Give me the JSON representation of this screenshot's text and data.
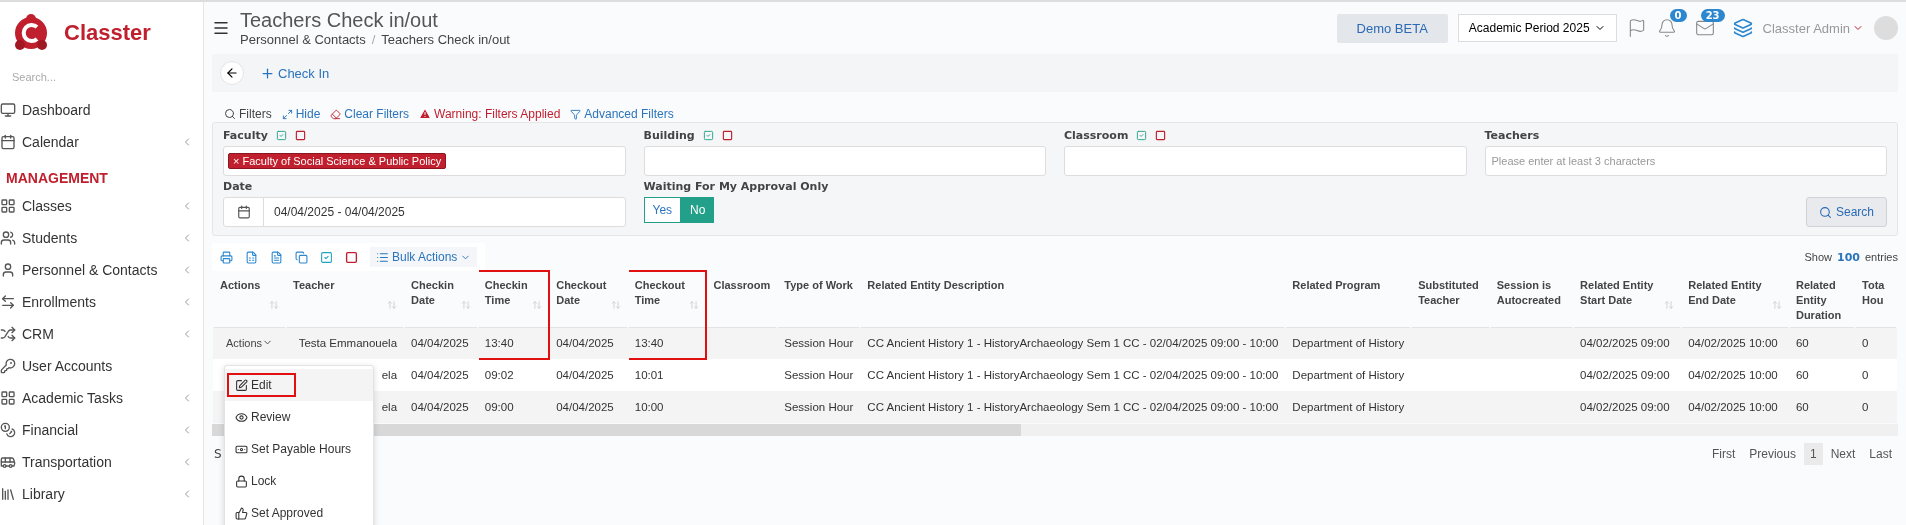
{
  "brand": {
    "name": "Classter"
  },
  "sidebar": {
    "search_placeholder": "Search...",
    "items": [
      {
        "label": "Dashboard",
        "kind": "link",
        "expandable": false
      },
      {
        "label": "Calendar",
        "kind": "link",
        "expandable": true
      },
      {
        "label": "MANAGEMENT",
        "kind": "section"
      },
      {
        "label": "Classes",
        "kind": "link",
        "expandable": true
      },
      {
        "label": "Students",
        "kind": "link",
        "expandable": true
      },
      {
        "label": "Personnel & Contacts",
        "kind": "link",
        "expandable": true
      },
      {
        "label": "Enrollments",
        "kind": "link",
        "expandable": true
      },
      {
        "label": "CRM",
        "kind": "link",
        "expandable": true
      },
      {
        "label": "User Accounts",
        "kind": "link",
        "expandable": false
      },
      {
        "label": "Academic Tasks",
        "kind": "link",
        "expandable": true
      },
      {
        "label": "Financial",
        "kind": "link",
        "expandable": true
      },
      {
        "label": "Transportation",
        "kind": "link",
        "expandable": true
      },
      {
        "label": "Library",
        "kind": "link",
        "expandable": true
      }
    ]
  },
  "header": {
    "title": "Teachers Check in/out",
    "breadcrumb": [
      "Personnel & Contacts",
      "Teachers Check in/out"
    ],
    "breadcrumb_separator": "/",
    "demo_button": "Demo BETA",
    "period": "Academic Period 2025",
    "notifications": "0",
    "messages": "23",
    "user": "Classter Admin"
  },
  "toolbar": {
    "check_in": "Check In"
  },
  "filters": {
    "label": "Filters",
    "hide": "Hide",
    "clear": "Clear Filters",
    "warning": "Warning: Filters Applied",
    "advanced": "Advanced Filters",
    "fields": [
      {
        "label": "Faculty",
        "kind": "tags",
        "tags": [
          {
            "remove": "×",
            "label": "Faculty of Social Science & Public Policy"
          }
        ]
      },
      {
        "label": "Building",
        "kind": "tags"
      },
      {
        "label": "Classroom",
        "kind": "tags"
      },
      {
        "label": "Teachers",
        "kind": "text",
        "placeholder": "Please enter at least 3 characters"
      }
    ],
    "date": {
      "label": "Date",
      "value": "04/04/2025 - 04/04/2025"
    },
    "approval": {
      "label": "Waiting For My Approval Only",
      "options": [
        {
          "label": "Yes",
          "selected": false
        },
        {
          "label": "No",
          "selected": true
        }
      ]
    },
    "search_button": "Search"
  },
  "table_tools": {
    "bulk_actions": "Bulk Actions",
    "show": "Show",
    "page_size": "100",
    "entries": "entries"
  },
  "table": {
    "columns": [
      {
        "label": "Actions",
        "sortable": true,
        "highlighted": false
      },
      {
        "label": "Teacher",
        "sortable": true,
        "highlighted": false
      },
      {
        "label": "Checkin Date",
        "sortable": true,
        "highlighted": false
      },
      {
        "label": "Checkin Time",
        "sortable": true,
        "highlighted": true
      },
      {
        "label": "Checkout Date",
        "sortable": true,
        "highlighted": false
      },
      {
        "label": "Checkout Time",
        "sortable": true,
        "highlighted": true
      },
      {
        "label": "Classroom",
        "sortable": false,
        "highlighted": false
      },
      {
        "label": "Type of Work",
        "sortable": false,
        "highlighted": false
      },
      {
        "label": "Related Entity Description",
        "sortable": false,
        "highlighted": false
      },
      {
        "label": "Related Program",
        "sortable": false,
        "highlighted": false
      },
      {
        "label": "Substituted Teacher",
        "sortable": false,
        "highlighted": false
      },
      {
        "label": "Session is Autocreated",
        "sortable": false,
        "highlighted": false
      },
      {
        "label": "Related Entity Start Date",
        "sortable": true,
        "highlighted": false
      },
      {
        "label": "Related Entity End Date",
        "sortable": true,
        "highlighted": false
      },
      {
        "label": "Related Entity Duration",
        "sortable": false,
        "highlighted": false
      },
      {
        "label": "Tota Hou",
        "sortable": false,
        "highlighted": false
      }
    ],
    "rows": [
      {
        "cells": [
          "Actions",
          "Testa Emmanouela",
          "04/04/2025",
          "13:40",
          "04/04/2025",
          "13:40",
          "",
          "Session Hour",
          "CC Ancient History 1 - HistoryArchaeology Sem 1 CC - 02/04/2025 09:00 - 10:00",
          "Department of History",
          "",
          "",
          "04/02/2025 09:00",
          "04/02/2025 10:00",
          "60",
          "0"
        ]
      },
      {
        "cells": [
          "",
          "ela",
          "04/04/2025",
          "09:02",
          "04/04/2025",
          "10:01",
          "",
          "Session Hour",
          "CC Ancient History 1 - HistoryArchaeology Sem 1 CC - 02/04/2025 09:00 - 10:00",
          "Department of History",
          "",
          "",
          "04/02/2025 09:00",
          "04/02/2025 10:00",
          "60",
          "0"
        ]
      },
      {
        "cells": [
          "",
          "ela",
          "04/04/2025",
          "09:00",
          "04/04/2025",
          "10:00",
          "",
          "Session Hour",
          "CC Ancient History 1 - HistoryArchaeology Sem 1 CC - 02/04/2025 09:00 - 10:00",
          "Department of History",
          "",
          "",
          "04/02/2025 09:00",
          "04/02/2025 10:00",
          "60",
          "0"
        ]
      }
    ]
  },
  "action_menu": [
    {
      "label": "Edit",
      "highlighted": true
    },
    {
      "label": "Review",
      "highlighted": false
    },
    {
      "label": "Set Payable Hours",
      "highlighted": false
    },
    {
      "label": "Lock",
      "highlighted": false
    },
    {
      "label": "Set Approved",
      "highlighted": false
    }
  ],
  "pagination": {
    "info": "S",
    "buttons": [
      {
        "label": "First",
        "selected": false
      },
      {
        "label": "Previous",
        "selected": false
      },
      {
        "label": "1",
        "selected": true
      },
      {
        "label": "Next",
        "selected": false
      },
      {
        "label": "Last",
        "selected": false
      }
    ]
  }
}
